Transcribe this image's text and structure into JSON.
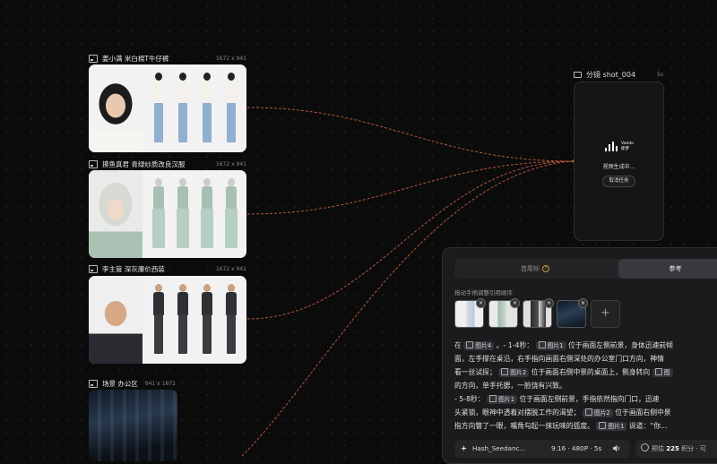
{
  "nodes": [
    {
      "title": "姜小满 米白棉T牛仔裤",
      "dims": "1672 x 941"
    },
    {
      "title": "摸鱼真君 青绿纱质改良汉服",
      "dims": "1672 x 941"
    },
    {
      "title": "李主管 深灰廉价西装",
      "dims": "1672 x 941"
    },
    {
      "title": "场景 办公区",
      "dims": "941 x 1672"
    }
  ],
  "shot": {
    "title": "分镜 shot_004",
    "duration": "5s",
    "logo_line1": "Veedo",
    "logo_line2": "即梦",
    "status": "视频生成中...",
    "cancel_label": "取消任务"
  },
  "panel": {
    "tab_tail": "首尾帧",
    "tab_ref": "参考",
    "drag_hint": "拖动手柄调整引用顺序",
    "add_glyph": "+",
    "prompt": {
      "l1_a": "在",
      "l1_chip1": "图片4",
      "l1_b": "。- 1-4秒：",
      "l1_chip2": "图片1",
      "l1_c": "位于画面左侧前景，身体迅速前倾",
      "l2": "面，左手撑在桌沿，右手指向画面右侧深处的办公室门口方向，神情",
      "l3_a": "看一丝试探；",
      "l3_chip": "图片2",
      "l3_b": "位于画面右侧中景的桌面上，侧身转向",
      "l3_chip2": "图",
      "l4": "的方向，单手托腮，一脸饶有兴致。",
      "l5_a": "- 5-8秒：",
      "l5_chip": "图片1",
      "l5_b": "位于画面左侧前景，手指依然指向门口，迅速",
      "l6_a": "头紧锁，眼神中透着对摆脱工作的渴望；",
      "l6_chip": "图片2",
      "l6_b": "位于画面右侧中景",
      "l7_a": "指方向瞥了一眼，嘴角勾起一抹玩味的弧度。",
      "l7_chip": "图片1",
      "l7_b": "说道：“你..."
    },
    "model_name": "Hash_Seedanc...",
    "model_spec": "9:16 · 480P · 5s",
    "cost_prefix": "预估",
    "cost_value": "225",
    "cost_suffix": "积分 · 可"
  }
}
